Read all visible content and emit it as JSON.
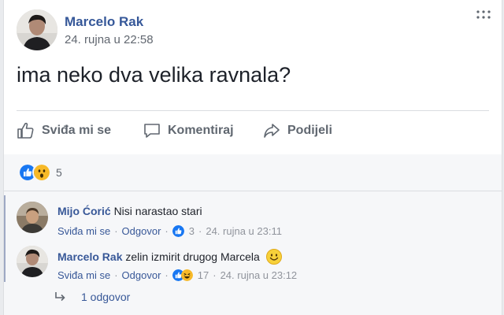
{
  "post": {
    "author": "Marcelo Rak",
    "time": "24. rujna u 22:58",
    "text": "ima neko dva velika ravnala?"
  },
  "actions": {
    "like": "Sviđa mi se",
    "comment": "Komentiraj",
    "share": "Podijeli"
  },
  "reactions": {
    "count": "5",
    "types": [
      "like-icon",
      "wow-icon"
    ]
  },
  "comments": [
    {
      "author": "Mijo Ćorić",
      "text": "Nisi narastao stari",
      "like": "Sviđa mi se",
      "reply": "Odgovor",
      "reaction_count": "3",
      "time": "24. rujna u 23:11"
    },
    {
      "author": "Marcelo Rak",
      "text": "zelin izmirit drugog Marcela",
      "emoji": "smile-emoji-icon",
      "like": "Sviđa mi se",
      "reply": "Odgovor",
      "reaction_count": "17",
      "time": "24. rujna u 23:12"
    }
  ],
  "replies": {
    "label": "1 odgovor"
  },
  "colors": {
    "link": "#365899",
    "like_blue": "#1877f2",
    "wow_yellow": "#f7b928"
  }
}
